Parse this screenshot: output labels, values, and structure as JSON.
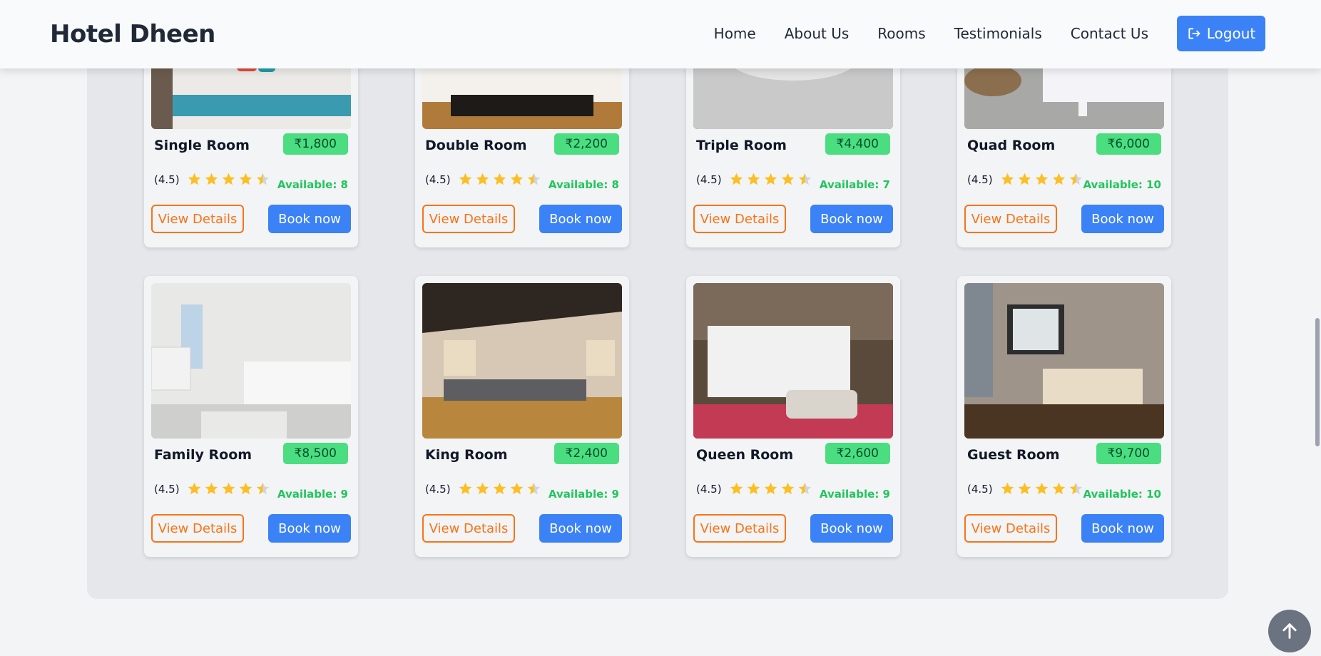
{
  "header": {
    "brand": "Hotel Dheen",
    "nav": [
      "Home",
      "About Us",
      "Rooms",
      "Testimonials",
      "Contact Us"
    ],
    "logout_label": "Logout"
  },
  "rooms": [
    {
      "name": "Single Room",
      "price": "₹1,800",
      "rating": "(4.5)",
      "available": "Available: 8"
    },
    {
      "name": "Double Room",
      "price": "₹2,200",
      "rating": "(4.5)",
      "available": "Available: 8"
    },
    {
      "name": "Triple Room",
      "price": "₹4,400",
      "rating": "(4.5)",
      "available": "Available: 7"
    },
    {
      "name": "Quad Room",
      "price": "₹6,000",
      "rating": "(4.5)",
      "available": "Available: 10"
    },
    {
      "name": "Family Room",
      "price": "₹8,500",
      "rating": "(4.5)",
      "available": "Available: 9"
    },
    {
      "name": "King Room",
      "price": "₹2,400",
      "rating": "(4.5)",
      "available": "Available: 9"
    },
    {
      "name": "Queen Room",
      "price": "₹2,600",
      "rating": "(4.5)",
      "available": "Available: 9"
    },
    {
      "name": "Guest Room",
      "price": "₹9,700",
      "rating": "(4.5)",
      "available": "Available: 10"
    }
  ],
  "buttons": {
    "view_details": "View Details",
    "book_now": "Book now"
  },
  "stars_filled": 4.5,
  "colors": {
    "primary": "#3b82f6",
    "accent_orange": "#f97316",
    "price_badge": "#4ade80",
    "available_text": "#22c55e",
    "star": "#fbbf24"
  }
}
